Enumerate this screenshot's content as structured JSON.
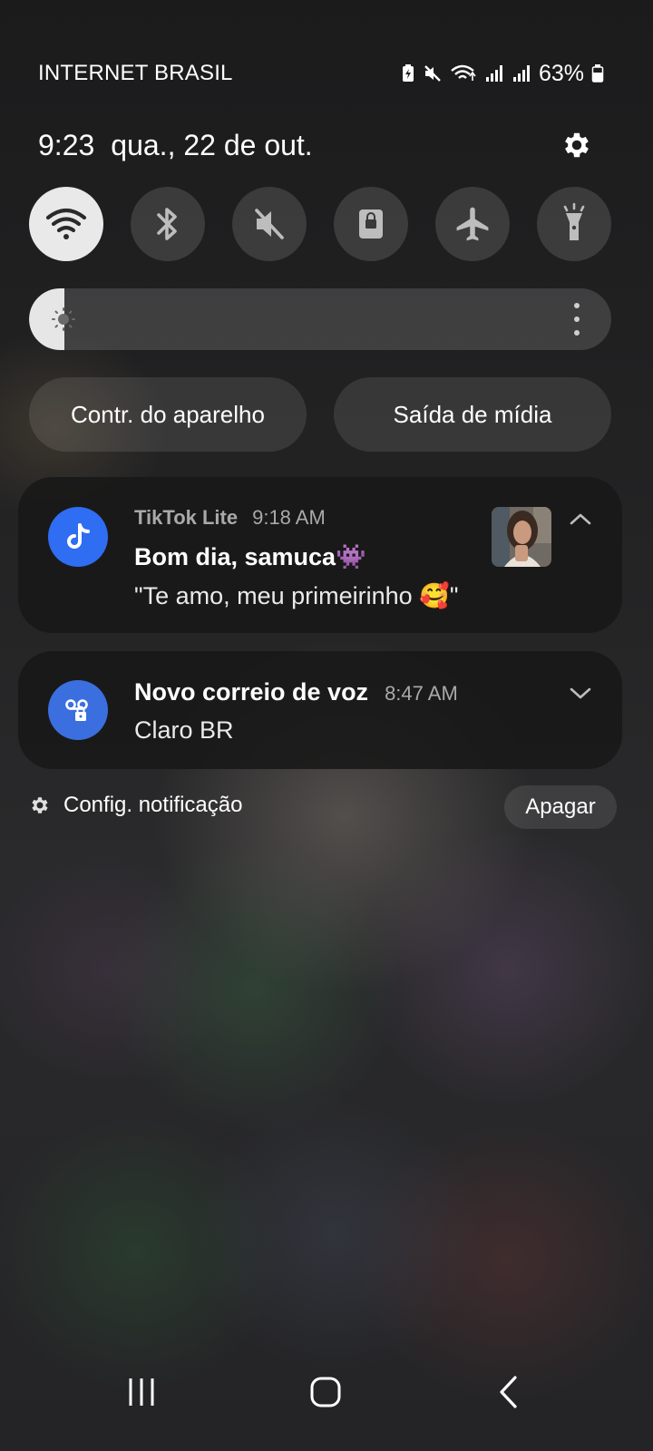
{
  "status_bar": {
    "carrier": "INTERNET BRASIL",
    "battery_percent": "63%",
    "icons": [
      "battery-saver-icon",
      "mute-icon",
      "wifi-icon",
      "signal-icon",
      "signal-icon",
      "battery-icon"
    ]
  },
  "header": {
    "time": "9:23",
    "date": "qua., 22 de out.",
    "settings_icon": "gear-icon"
  },
  "quick_toggles": [
    {
      "name": "wifi",
      "icon": "wifi-icon",
      "active": true
    },
    {
      "name": "bluetooth",
      "icon": "bluetooth-icon",
      "active": false
    },
    {
      "name": "mute",
      "icon": "mute-icon",
      "active": false
    },
    {
      "name": "rotation-lock",
      "icon": "lock-icon",
      "active": false
    },
    {
      "name": "airplane",
      "icon": "airplane-icon",
      "active": false
    },
    {
      "name": "flashlight",
      "icon": "flashlight-icon",
      "active": false
    }
  ],
  "brightness": {
    "level": 0.06,
    "icon": "sun-icon",
    "more_icon": "more-vertical-icon"
  },
  "pills": {
    "device_control": "Contr. do aparelho",
    "media_output": "Saída de mídia"
  },
  "notifications": [
    {
      "app": "TikTok Lite",
      "time": "9:18 AM",
      "title": "Bom dia, samuca👾",
      "body": "\"Te amo, meu primeirinho 🥰\"",
      "icon": "tiktok-icon",
      "expand_icon": "chevron-up-icon",
      "accent": "#2f6df2"
    },
    {
      "title": "Novo correio de voz",
      "time": "8:47 AM",
      "body": "Claro BR",
      "icon": "voicemail-icon",
      "expand_icon": "chevron-down-icon",
      "accent": "#3b6fdf"
    }
  ],
  "footer": {
    "notification_settings": "Config. notificação",
    "clear": "Apagar"
  },
  "nav_bar": {
    "recent_icon": "recent-apps-icon",
    "home_icon": "home-icon",
    "back_icon": "back-icon"
  }
}
